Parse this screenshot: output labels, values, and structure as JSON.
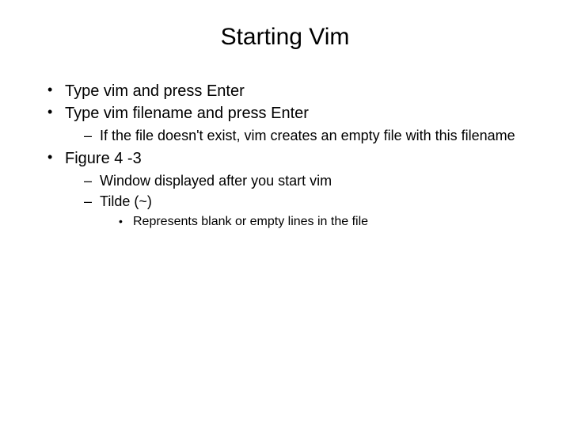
{
  "title": "Starting Vim",
  "bullets": {
    "b1": "Type vim and press Enter",
    "b2": "Type vim filename and press Enter",
    "b2_sub1": "If the file doesn't exist, vim creates an empty file with this filename",
    "b3": "Figure 4 -3",
    "b3_sub1": "Window displayed after you start vim",
    "b3_sub2": "Tilde (~)",
    "b3_sub2_sub1": "Represents blank or empty lines in the file"
  }
}
